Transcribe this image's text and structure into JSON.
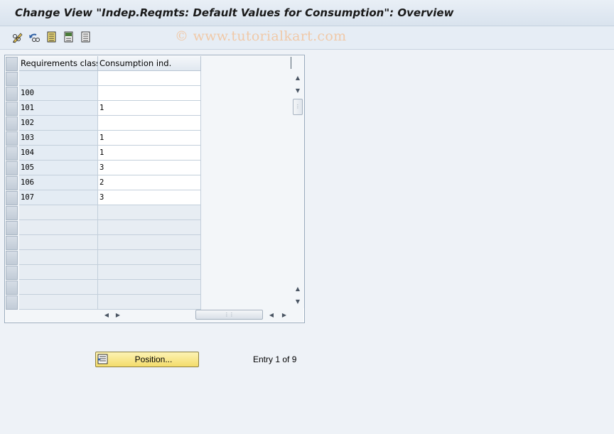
{
  "window": {
    "title": "Change View \"Indep.Reqmts: Default Values for Consumption\": Overview"
  },
  "toolbar": {
    "icons": [
      "edit-glasses-icon",
      "undo-change-icon",
      "select-all-icon",
      "deselect-all-icon",
      "select-block-icon"
    ]
  },
  "watermark": "© www.tutorialkart.com",
  "table": {
    "columns": [
      "Requirements class",
      "Consumption ind."
    ],
    "rows": [
      {
        "req_class": "",
        "consumption": ""
      },
      {
        "req_class": "100",
        "consumption": ""
      },
      {
        "req_class": "101",
        "consumption": "1"
      },
      {
        "req_class": "102",
        "consumption": ""
      },
      {
        "req_class": "103",
        "consumption": "1"
      },
      {
        "req_class": "104",
        "consumption": "1"
      },
      {
        "req_class": "105",
        "consumption": "3"
      },
      {
        "req_class": "106",
        "consumption": "2"
      },
      {
        "req_class": "107",
        "consumption": "3"
      }
    ],
    "empty_rows": 7
  },
  "footer": {
    "position_button": "Position...",
    "entry_text": "Entry 1 of 9"
  },
  "colors": {
    "position_button": "#f3dc6a",
    "watermark": "#f0c9a8"
  }
}
